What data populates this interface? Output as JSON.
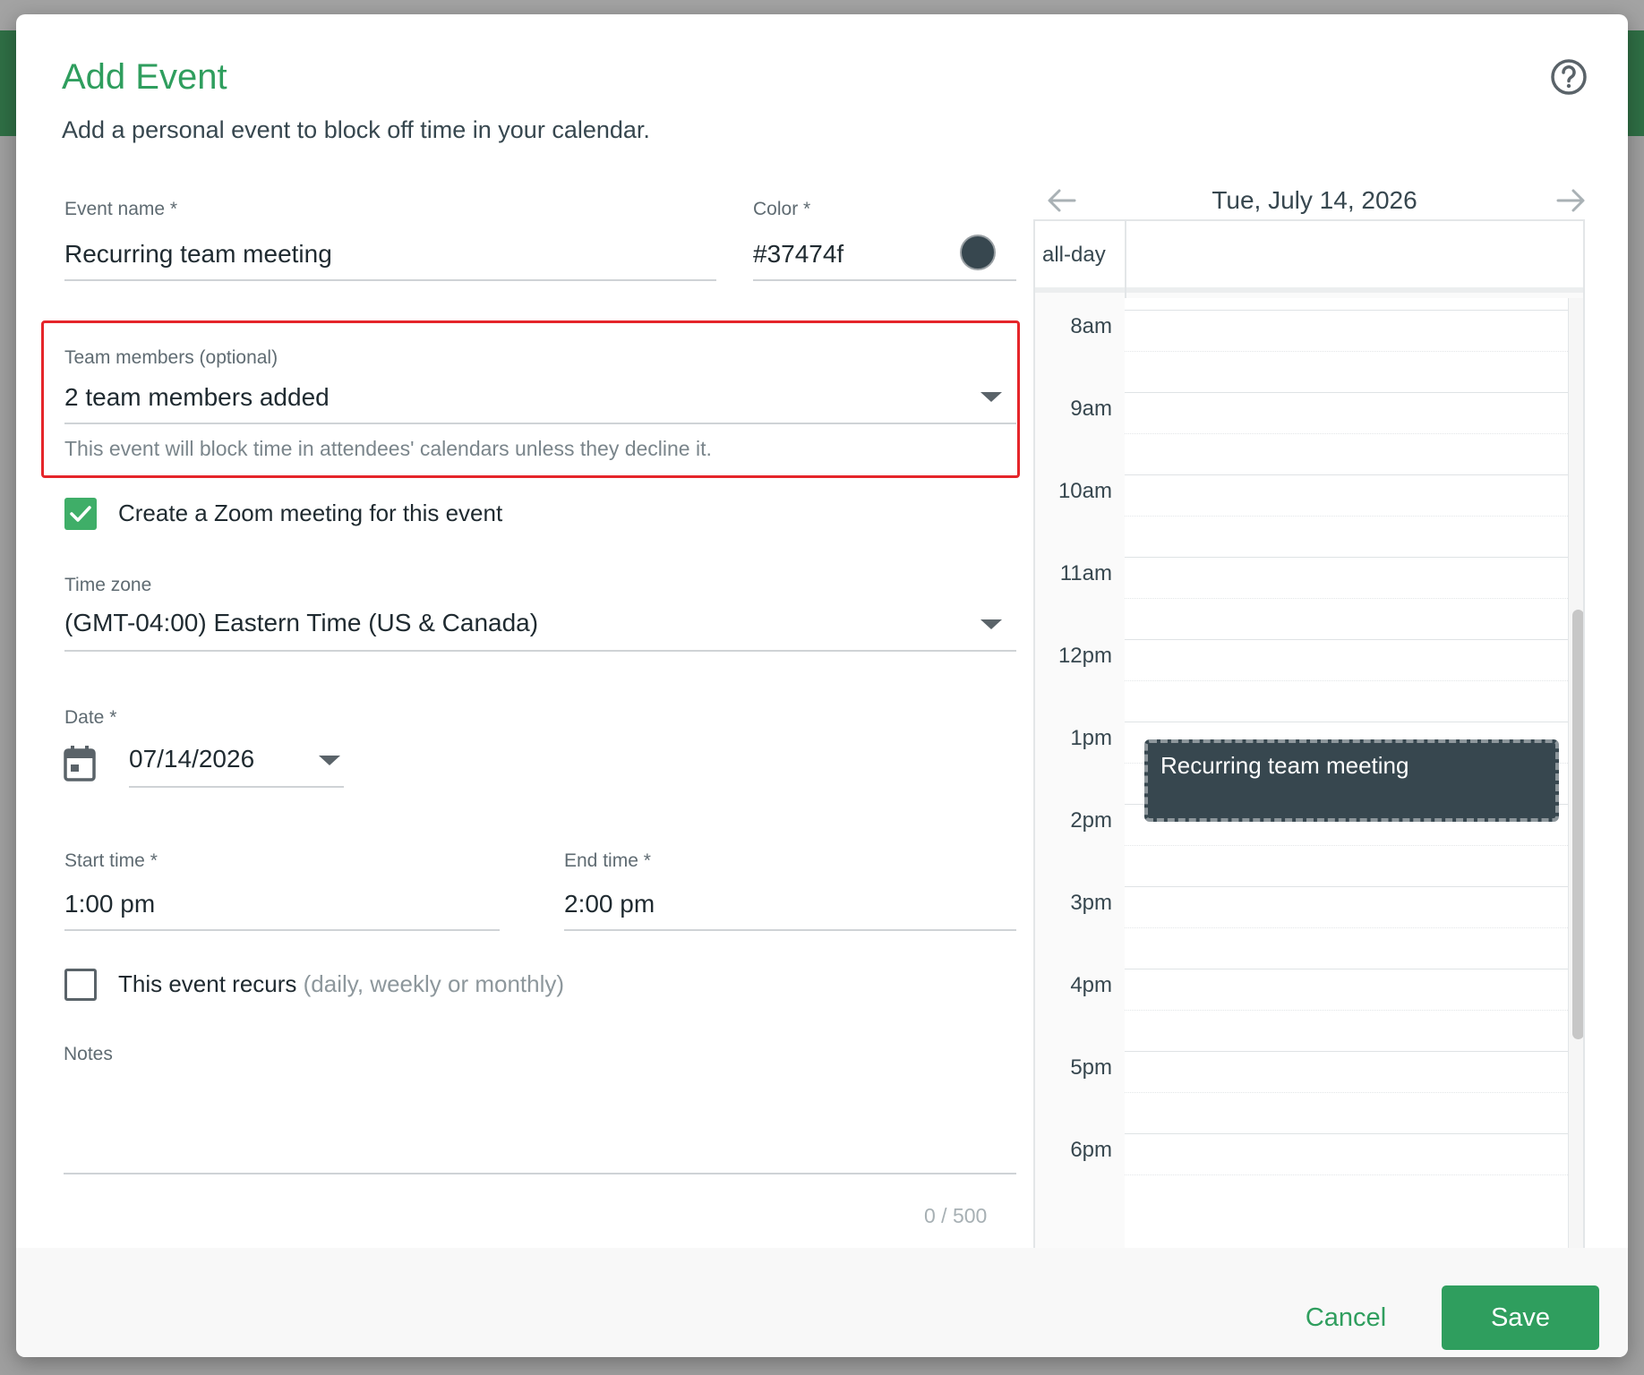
{
  "dialog": {
    "title": "Add Event",
    "subtitle": "Add a personal event to block off time in your calendar."
  },
  "icons": {
    "help": "help-circle-icon",
    "calendar": "calendar-icon",
    "dropdown": "caret-down-icon",
    "prev": "arrow-left-icon",
    "next": "arrow-right-icon",
    "check": "checkmark-icon"
  },
  "form": {
    "event_name": {
      "label": "Event name",
      "required_mark": "*",
      "value": "Recurring team meeting"
    },
    "color": {
      "label": "Color",
      "required_mark": "*",
      "value": "#37474f",
      "swatch": "#37474f"
    },
    "team_members": {
      "label": "Team members (optional)",
      "value": "2 team members added",
      "hint": "This event will block time in attendees' calendars unless they decline it."
    },
    "zoom": {
      "label": "Create a Zoom meeting for this event",
      "checked": true
    },
    "time_zone": {
      "label": "Time zone",
      "value": "(GMT-04:00) Eastern Time (US & Canada)"
    },
    "date": {
      "label": "Date",
      "required_mark": "*",
      "value": "07/14/2026"
    },
    "start_time": {
      "label": "Start time",
      "required_mark": "*",
      "value": "1:00 pm"
    },
    "end_time": {
      "label": "End time",
      "required_mark": "*",
      "value": "2:00 pm"
    },
    "recurs": {
      "label": "This event recurs",
      "hint": "(daily, weekly or monthly)",
      "checked": false
    },
    "notes": {
      "label": "Notes",
      "value": "",
      "counter": "0 / 500"
    }
  },
  "calendar": {
    "date_label": "Tue, July 14, 2026",
    "allday_label": "all-day",
    "hours": [
      "8am",
      "9am",
      "10am",
      "11am",
      "12pm",
      "1pm",
      "2pm",
      "3pm",
      "4pm",
      "5pm",
      "6pm"
    ],
    "event": {
      "title": "Recurring team meeting",
      "color": "#37474f"
    }
  },
  "actions": {
    "cancel": "Cancel",
    "save": "Save"
  },
  "colors": {
    "accent": "#2f9e5e",
    "highlight_border": "#e5252a",
    "checkbox_checked": "#3fae68"
  }
}
